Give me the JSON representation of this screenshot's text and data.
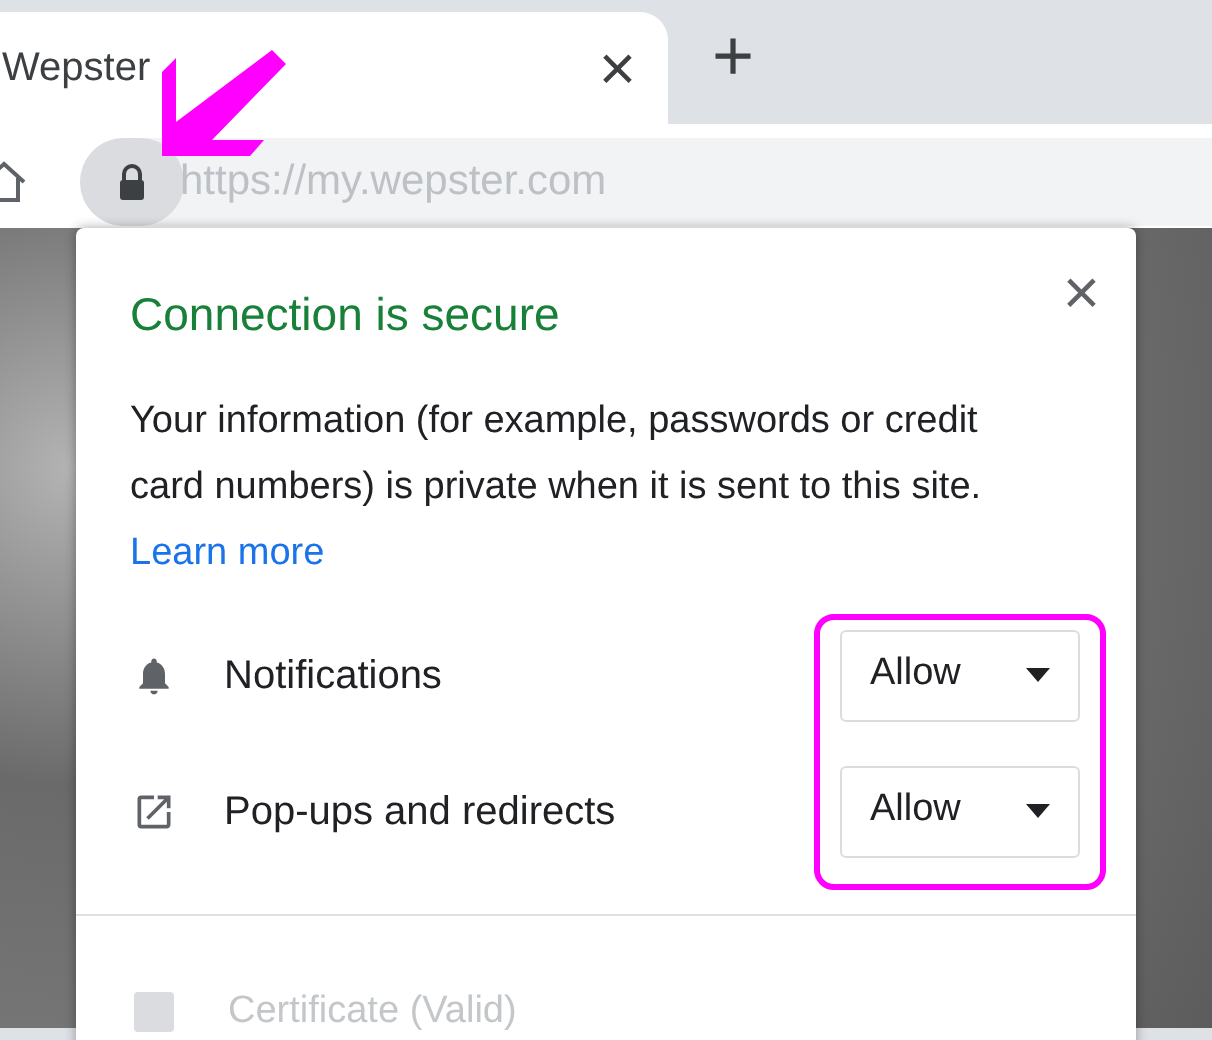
{
  "tab": {
    "title": "Wepster",
    "close": "×"
  },
  "new_tab": "+",
  "address_bar": {
    "url": "https://my.wepster.com"
  },
  "popup": {
    "title": "Connection is secure",
    "close": "×",
    "message": "Your information (for example, passwords or credit card numbers) is private when it is sent to this site.",
    "link": "Learn more",
    "permissions": [
      {
        "kind": "notifications",
        "label": "Notifications",
        "value": "Allow"
      },
      {
        "kind": "popups",
        "label": "Pop-ups and redirects",
        "value": "Allow"
      }
    ],
    "certificate": {
      "label": "Certificate",
      "status": "(Valid)",
      "disabled": true
    }
  }
}
